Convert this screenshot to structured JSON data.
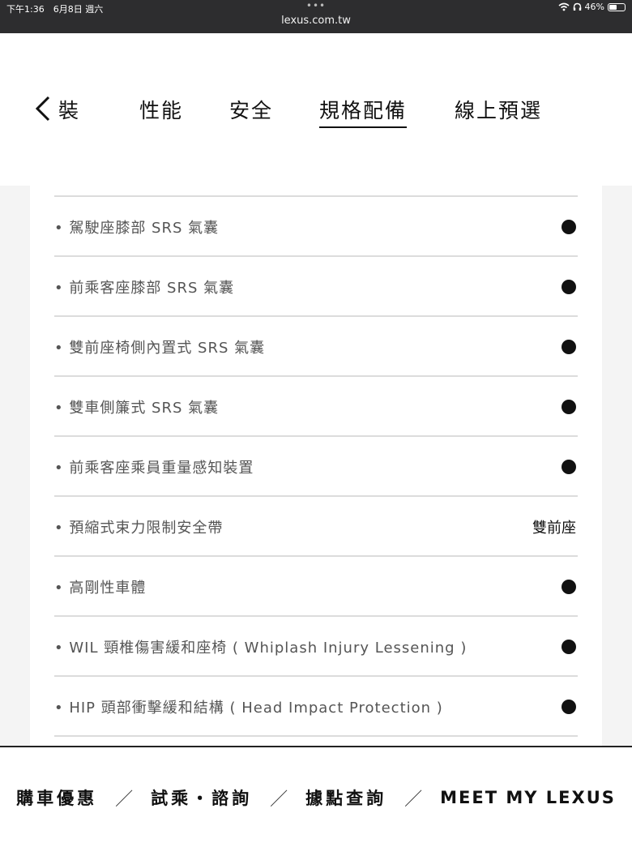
{
  "status_bar": {
    "time": "下午1:36　6月8日 週六",
    "dots": "•••",
    "url": "lexus.com.tw",
    "battery": "46%"
  },
  "tabs": {
    "items": [
      "裝",
      "性能",
      "安全",
      "規格配備",
      "線上預選"
    ],
    "active_index": 3
  },
  "spec_rows": [
    {
      "label": "• 駕駛座膝部 SRS 氣囊",
      "value": "●"
    },
    {
      "label": "• 前乘客座膝部 SRS 氣囊",
      "value": "●"
    },
    {
      "label": "• 雙前座椅側內置式 SRS 氣囊",
      "value": "●"
    },
    {
      "label": "• 雙車側簾式 SRS 氣囊",
      "value": "●"
    },
    {
      "label": "• 前乘客座乘員重量感知裝置",
      "value": "●"
    },
    {
      "label": "• 預縮式束力限制安全帶",
      "value": "雙前座"
    },
    {
      "label": "• 高剛性車體",
      "value": "●"
    },
    {
      "label": "• WIL 頸椎傷害緩和座椅 ( Whiplash Injury Lessening )",
      "value": "●"
    },
    {
      "label": "• HIP 頭部衝擊緩和結構 ( Head Impact Protection )",
      "value": "●"
    }
  ],
  "footer": {
    "links": [
      "購車優惠",
      "試乘・諮詢",
      "據點查詢",
      "MEET MY LEXUS"
    ],
    "separator": "／"
  },
  "icons": {
    "back": "chevron-left-icon",
    "wifi": "wifi-icon",
    "headphones": "headphones-icon",
    "battery": "battery-icon"
  }
}
